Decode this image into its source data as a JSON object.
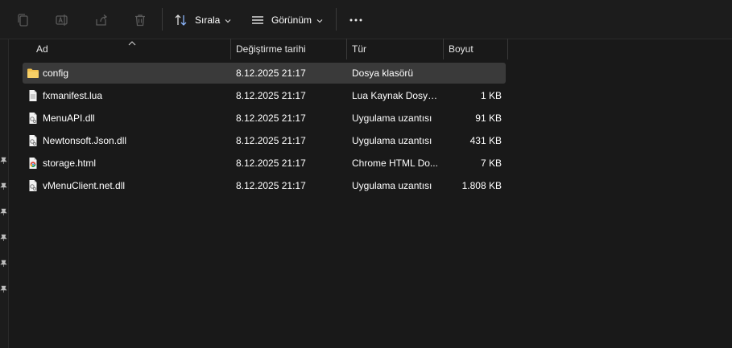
{
  "toolbar": {
    "sort_label": "Sırala",
    "view_label": "Görünüm"
  },
  "columns": {
    "name": "Ad",
    "date": "Değiştirme tarihi",
    "type": "Tür",
    "size": "Boyut"
  },
  "files": [
    {
      "name": "config",
      "date": "8.12.2025 21:17",
      "type": "Dosya klasörü",
      "size": "",
      "icon": "folder-icon"
    },
    {
      "name": "fxmanifest.lua",
      "date": "8.12.2025 21:17",
      "type": "Lua Kaynak Dosyası",
      "size": "1 KB",
      "icon": "text-file-icon"
    },
    {
      "name": "MenuAPI.dll",
      "date": "8.12.2025 21:17",
      "type": "Uygulama uzantısı",
      "size": "91 KB",
      "icon": "dll-file-icon"
    },
    {
      "name": "Newtonsoft.Json.dll",
      "date": "8.12.2025 21:17",
      "type": "Uygulama uzantısı",
      "size": "431 KB",
      "icon": "dll-file-icon"
    },
    {
      "name": "storage.html",
      "date": "8.12.2025 21:17",
      "type": "Chrome HTML Do...",
      "size": "7 KB",
      "icon": "chrome-html-icon"
    },
    {
      "name": "vMenuClient.net.dll",
      "date": "8.12.2025 21:17",
      "type": "Uygulama uzantısı",
      "size": "1.808 KB",
      "icon": "dll-file-icon"
    }
  ],
  "selected_row": 0,
  "colors": {
    "background": "#191919",
    "selection": "#3a3a3a",
    "folder": "#f2c14e"
  }
}
